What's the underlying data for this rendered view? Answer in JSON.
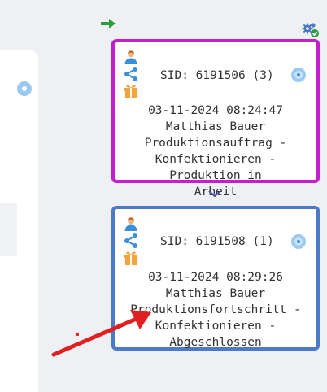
{
  "colors": {
    "card1_border": "#c41fcd",
    "card2_border": "#4d79c9",
    "annotation_arrow": "#e02020",
    "nav_arrow": "#2a9d3c"
  },
  "toolbar": {
    "forward_icon": "arrow-right-icon",
    "settings_icon": "gear-check-icon"
  },
  "cards": [
    {
      "sid": "SID: 6191506 (3)",
      "datetime": "03-11-2024 08:24:47",
      "user": "Matthias Bauer",
      "status_lines": [
        "Produktionsauftrag -",
        "Konfektionieren - Produktion in",
        "Arbeit"
      ],
      "icons": [
        "user-icon",
        "share-icon",
        "gift-icon",
        "disc-icon"
      ]
    },
    {
      "sid": "SID: 6191508 (1)",
      "datetime": "03-11-2024 08:29:26",
      "user": "Matthias Bauer",
      "status_lines": [
        "Produktionsfortschritt -",
        "Konfektionieren -",
        "Abgeschlossen"
      ],
      "icons": [
        "user-icon",
        "share-icon",
        "gift-icon",
        "disc-icon"
      ]
    }
  ],
  "connector_icon": "chevron-down-icon"
}
